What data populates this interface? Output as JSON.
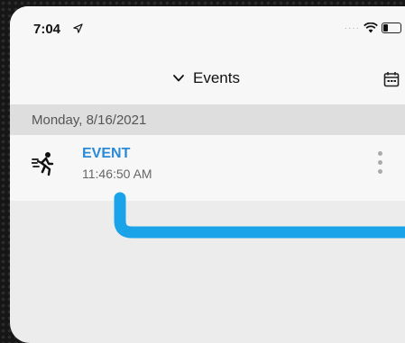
{
  "status_bar": {
    "time": "7:04",
    "location_icon": "location-arrow-icon",
    "signal_icon": "signal-dots-icon",
    "wifi_icon": "wifi-icon",
    "battery_icon": "battery-icon"
  },
  "nav": {
    "title": "Events",
    "dropdown_icon": "chevron-down-icon",
    "calendar_icon": "calendar-icon"
  },
  "date_header": "Monday, 8/16/2021",
  "events": [
    {
      "title": "EVENT",
      "time": "11:46:50 AM",
      "icon": "running-person-icon",
      "menu_icon": "more-vertical-icon"
    }
  ],
  "colors": {
    "accent": "#2a8ad8",
    "annotation": "#1aa3e8",
    "background": "#ececec",
    "frame": "#161616"
  }
}
